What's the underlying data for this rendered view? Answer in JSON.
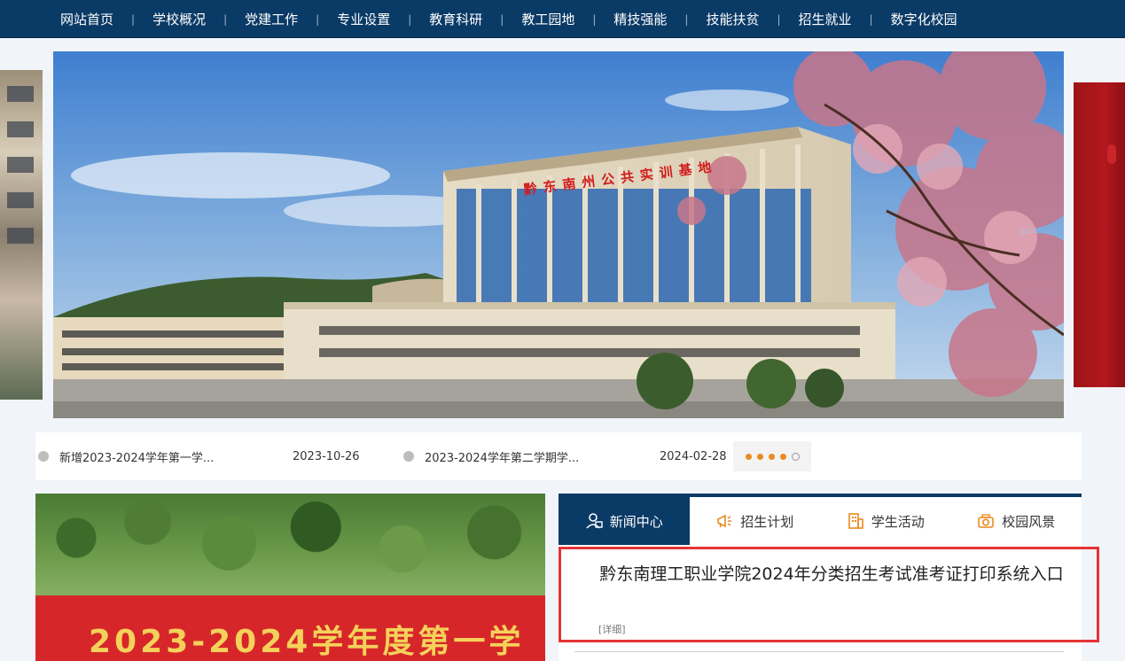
{
  "nav": {
    "items": [
      "网站首页",
      "学校概况",
      "党建工作",
      "专业设置",
      "教育科研",
      "教工园地",
      "精技强能",
      "技能扶贫",
      "招生就业",
      "数字化校园"
    ],
    "separator": "|"
  },
  "banner": {
    "building_sign": "黔东南州公共实训基地"
  },
  "ticker": {
    "items": [
      {
        "title": "新增2023-2024学年第一学...",
        "date": "2023-10-26"
      },
      {
        "title": "2023-2024学年第二学期学...",
        "date": "2024-02-28"
      }
    ],
    "pagination": {
      "total": 5,
      "active_index": 4
    }
  },
  "photo": {
    "banner_text": "2023-2024学年度第一学"
  },
  "tabs": {
    "items": [
      {
        "label": "新闻中心",
        "icon": "news-icon",
        "active": true
      },
      {
        "label": "招生计划",
        "icon": "megaphone-icon",
        "active": false
      },
      {
        "label": "学生活动",
        "icon": "activity-icon",
        "active": false
      },
      {
        "label": "校园风景",
        "icon": "camera-icon",
        "active": false
      }
    ],
    "headline": "黔东南理工职业学院2024年分类招生考试准考证打印系统入口",
    "detail_link": "[详细]"
  },
  "colors": {
    "nav_bg": "#0a3a66",
    "accent_orange": "#e98b1f",
    "highlight_red": "#e53335",
    "brand_red": "#b2181d"
  }
}
